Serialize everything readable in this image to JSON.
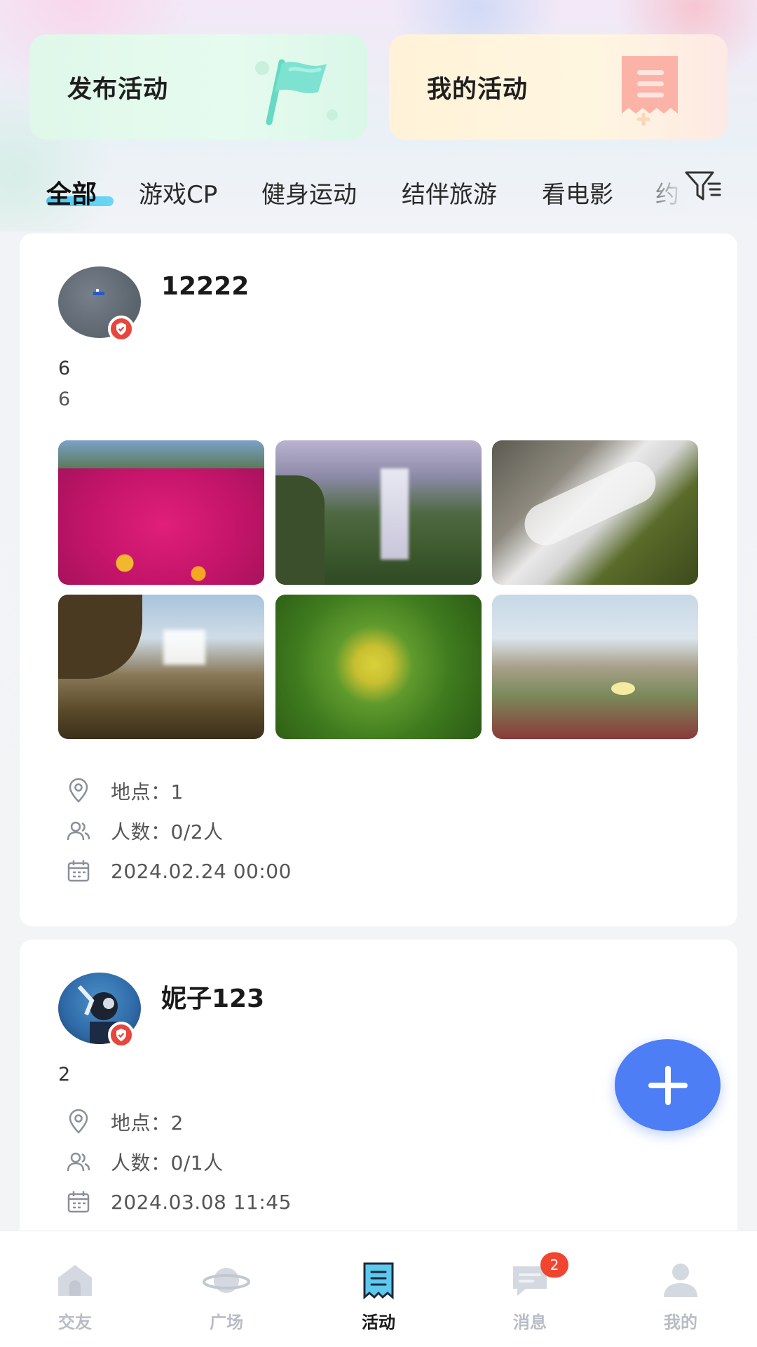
{
  "actions": {
    "publish_label": "发布活动",
    "mine_label": "我的活动"
  },
  "tabs": [
    {
      "label": "全部",
      "active": true
    },
    {
      "label": "游戏CP",
      "active": false
    },
    {
      "label": "健身运动",
      "active": false
    },
    {
      "label": "结伴旅游",
      "active": false
    },
    {
      "label": "看电影",
      "active": false
    },
    {
      "label": "约",
      "active": false
    }
  ],
  "posts": [
    {
      "username": "12222",
      "title": "6",
      "content": "6",
      "photos": [
        "flowers",
        "waterfall-valley",
        "waterfall-rocks",
        "waterfall-coast",
        "green-leaves",
        "beach-grass"
      ],
      "location": "地点：1",
      "people": "人数：0/2人",
      "datetime": "2024.02.24 00:00"
    },
    {
      "username": "妮子123",
      "title": "2",
      "location": "地点：2",
      "people": "人数：0/1人",
      "datetime": "2024.03.08 11:45"
    }
  ],
  "nav": [
    {
      "label": "交友",
      "icon": "home-icon",
      "active": false
    },
    {
      "label": "广场",
      "icon": "planet-icon",
      "active": false
    },
    {
      "label": "活动",
      "icon": "activity-icon",
      "active": true
    },
    {
      "label": "消息",
      "icon": "message-icon",
      "active": false,
      "badge": "2"
    },
    {
      "label": "我的",
      "icon": "profile-icon",
      "active": false
    }
  ],
  "colors": {
    "accent": "#4d7ef5",
    "tab_underline": "#4fc7f0",
    "badge": "#f2452f",
    "verify": "#e8453c"
  }
}
